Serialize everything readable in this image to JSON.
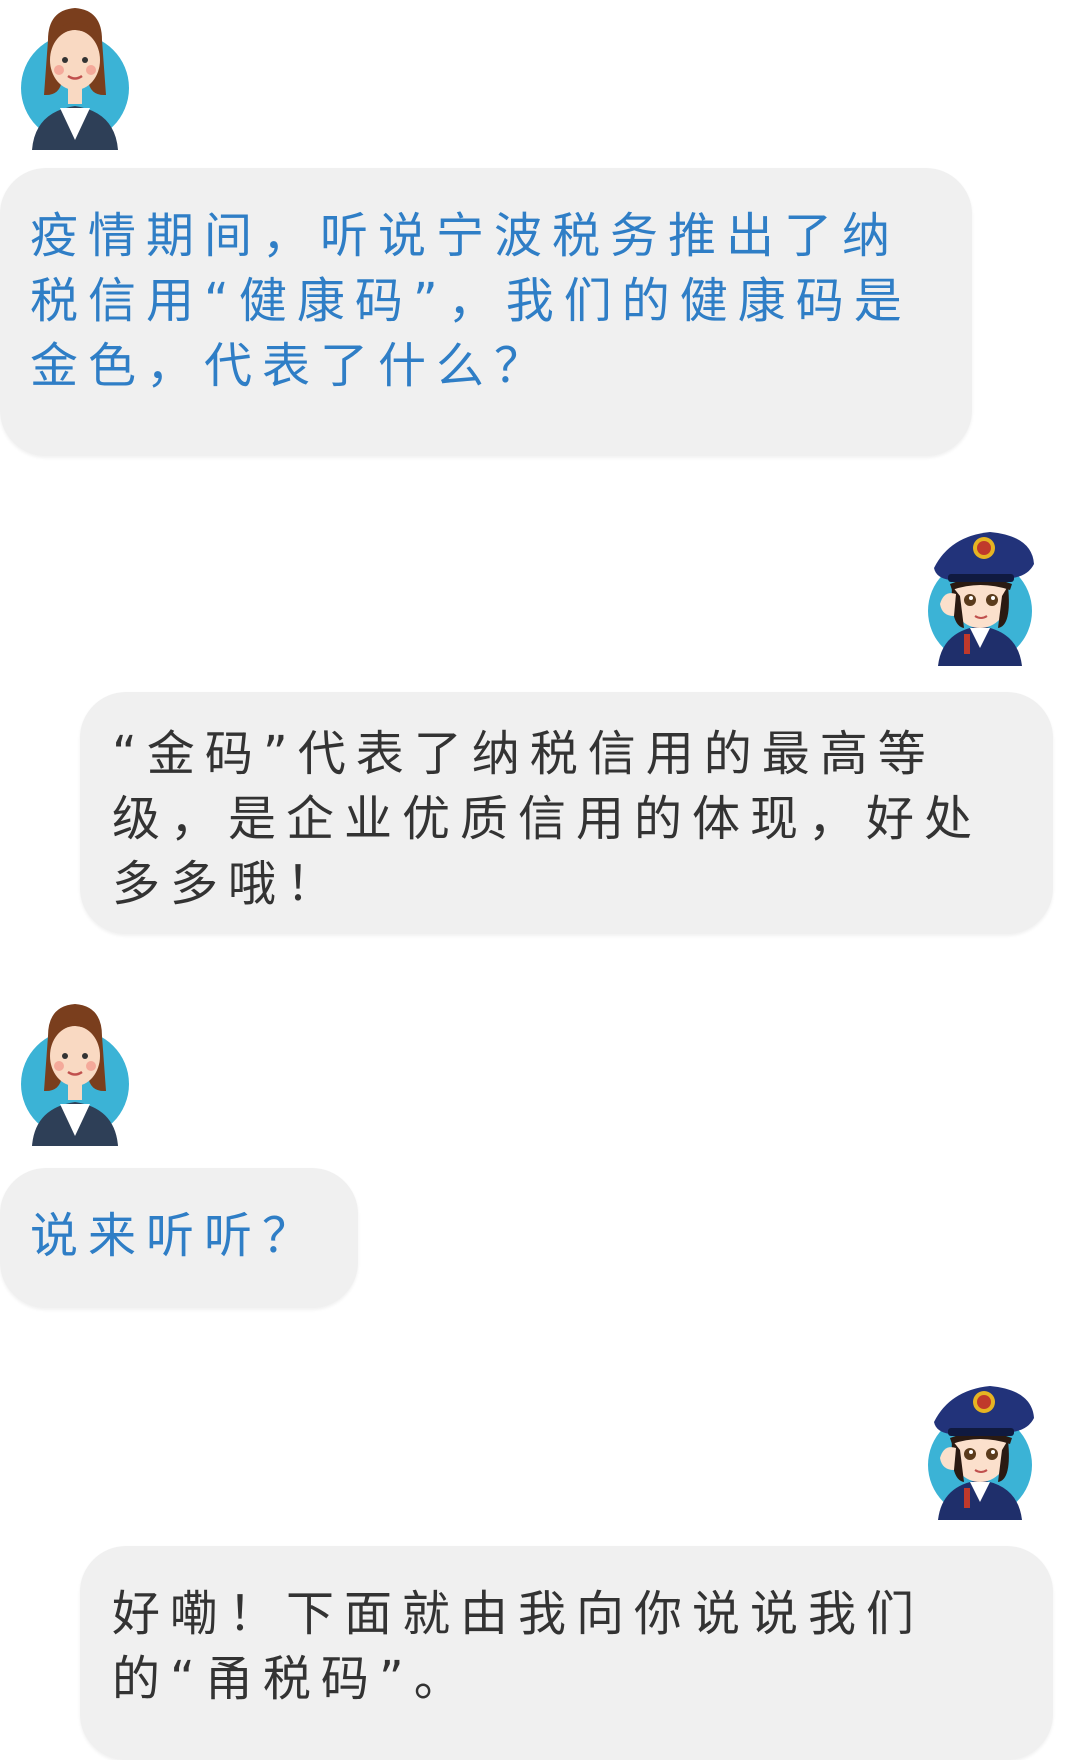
{
  "conversation": {
    "messages": [
      {
        "speaker": "taxpayer",
        "avatar_icon": "businesswoman-avatar-icon",
        "text": "疫情期间，听说宁波税务推出了纳税信用“健康码”，我们的健康码是金色，代表了什么？"
      },
      {
        "speaker": "tax-officer",
        "avatar_icon": "tax-officer-avatar-icon",
        "text": "“金码”代表了纳税信用的最高等级，是企业优质信用的体现，好处多多哦！"
      },
      {
        "speaker": "taxpayer",
        "avatar_icon": "businesswoman-avatar-icon",
        "text": "说来听听？"
      },
      {
        "speaker": "tax-officer",
        "avatar_icon": "tax-officer-avatar-icon",
        "text": "好嘞！下面就由我向你说说我们的“甬税码”。"
      }
    ]
  },
  "colors": {
    "question_text": "#2f7ec6",
    "answer_text": "#333333",
    "bubble_background": "#f0f0f0",
    "page_background": "#ffffff"
  }
}
